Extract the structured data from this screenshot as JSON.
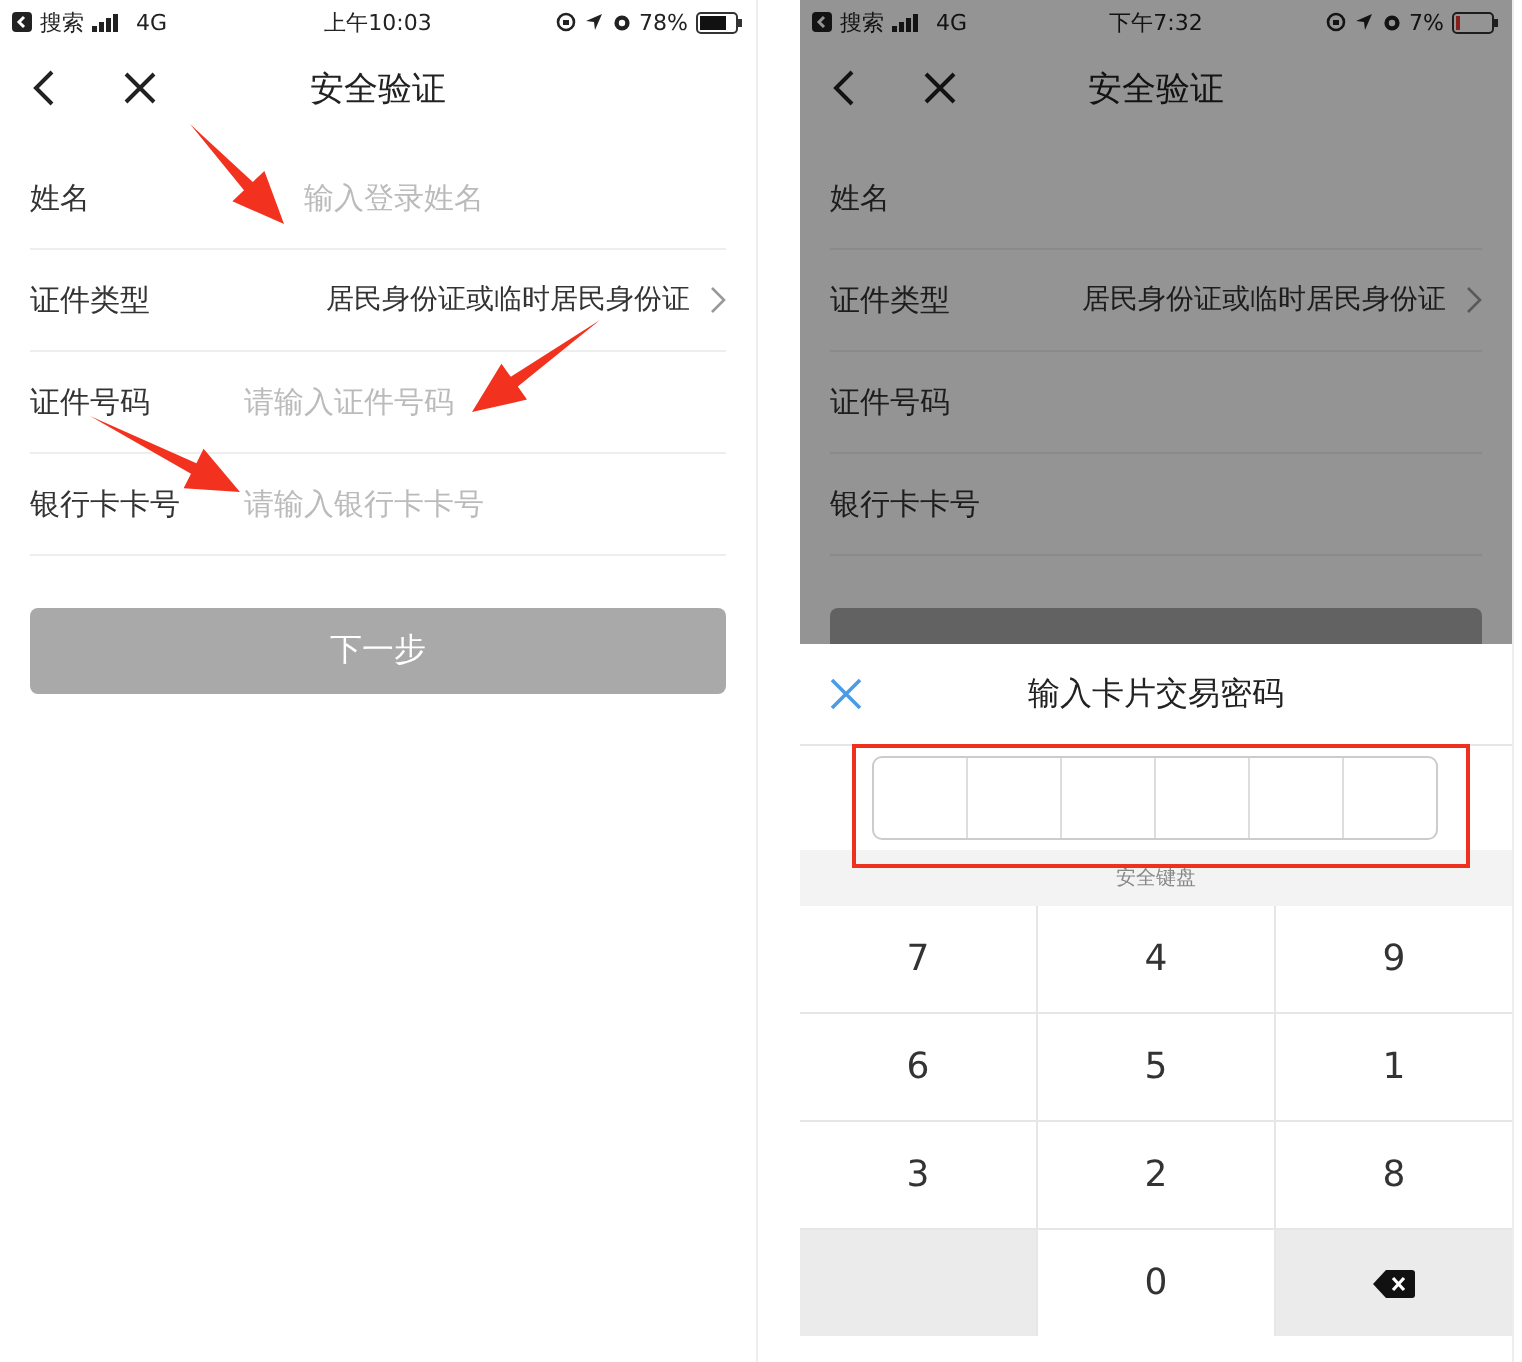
{
  "phones": [
    {
      "status": {
        "carrier": "搜索",
        "network": "4G",
        "time": "上午10:03",
        "battery": "78%",
        "battery_low": false
      },
      "nav": {
        "title": "安全验证"
      },
      "dimmed": false,
      "fields": [
        {
          "kind": "input",
          "label": "姓名",
          "placeholder": "输入登录姓名"
        },
        {
          "kind": "select",
          "label": "证件类型",
          "value": "居民身份证或临时居民身份证"
        },
        {
          "kind": "input",
          "label": "证件号码",
          "placeholder": "请输入证件号码"
        },
        {
          "kind": "input",
          "label": "银行卡卡号",
          "placeholder": "请输入银行卡卡号"
        }
      ],
      "next_button": {
        "label": "下一步",
        "disabled": true
      }
    },
    {
      "status": {
        "carrier": "搜索",
        "network": "4G",
        "time": "下午7:32",
        "battery": "7%",
        "battery_low": true
      },
      "nav": {
        "title": "安全验证"
      },
      "dimmed": true,
      "fields": [
        {
          "kind": "input",
          "label": "姓名"
        },
        {
          "kind": "select",
          "label": "证件类型",
          "value": "居民身份证或临时居民身份证"
        },
        {
          "kind": "input",
          "label": "证件号码"
        },
        {
          "kind": "input",
          "label": "银行卡卡号"
        }
      ],
      "next_button": {
        "disabled": true
      },
      "sheet": {
        "title": "输入卡片交易密码",
        "pin_boxes": [
          {
            "filled": false
          },
          {
            "filled": false
          },
          {
            "filled": false
          },
          {
            "filled": false
          },
          {
            "filled": false
          },
          {
            "filled": false
          }
        ],
        "keyboard_label": "安全键盘",
        "keys": [
          {
            "kind": "digit",
            "label": "7"
          },
          {
            "kind": "digit",
            "label": "4"
          },
          {
            "kind": "digit",
            "label": "9"
          },
          {
            "kind": "digit",
            "label": "6"
          },
          {
            "kind": "digit",
            "label": "5"
          },
          {
            "kind": "digit",
            "label": "1"
          },
          {
            "kind": "digit",
            "label": "3"
          },
          {
            "kind": "digit",
            "label": "2"
          },
          {
            "kind": "digit",
            "label": "8"
          },
          {
            "kind": "blank"
          },
          {
            "kind": "digit",
            "label": "0"
          },
          {
            "kind": "backspace"
          }
        ]
      }
    }
  ]
}
